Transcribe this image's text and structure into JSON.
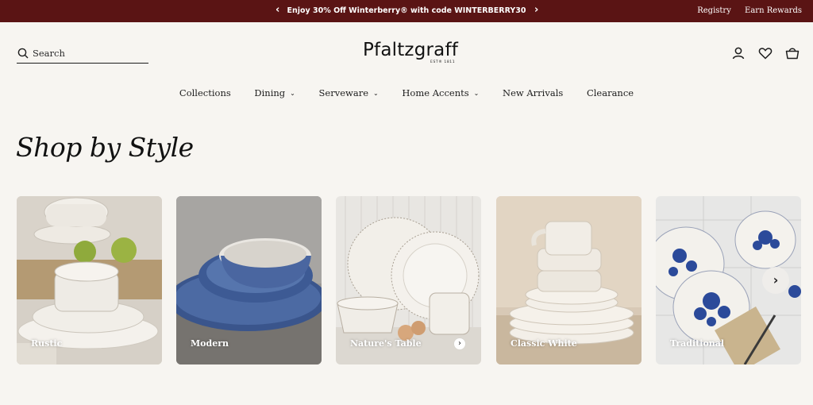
{
  "announcement": {
    "message": "Enjoy 30% Off Winterberry® with code WINTERBERRY30",
    "prev_icon": "chevron-left",
    "next_icon": "chevron-right",
    "links": [
      "Registry",
      "Earn Rewards"
    ]
  },
  "header": {
    "search_placeholder": "Search",
    "logo_text": "Pfaltzgraff",
    "logo_est": "EST® 1811",
    "icons": [
      "account-icon",
      "heart-icon",
      "cart-icon"
    ]
  },
  "nav": [
    {
      "label": "Collections",
      "dropdown": false
    },
    {
      "label": "Dining",
      "dropdown": true
    },
    {
      "label": "Serveware",
      "dropdown": true
    },
    {
      "label": "Home Accents",
      "dropdown": true
    },
    {
      "label": "New Arrivals",
      "dropdown": false
    },
    {
      "label": "Clearance",
      "dropdown": false
    }
  ],
  "section": {
    "title": "Shop by Style",
    "cards": [
      {
        "label": "Rustic"
      },
      {
        "label": "Modern"
      },
      {
        "label": "Nature's Table"
      },
      {
        "label": "Classic White"
      },
      {
        "label": "Traditional"
      }
    ]
  },
  "colors": {
    "announcement_bg": "#5a1414",
    "page_bg": "#f7f5f1",
    "text": "#1d1d1d",
    "modern_blue": "#3d5a94",
    "traditional_blue": "#2b4a9a"
  }
}
